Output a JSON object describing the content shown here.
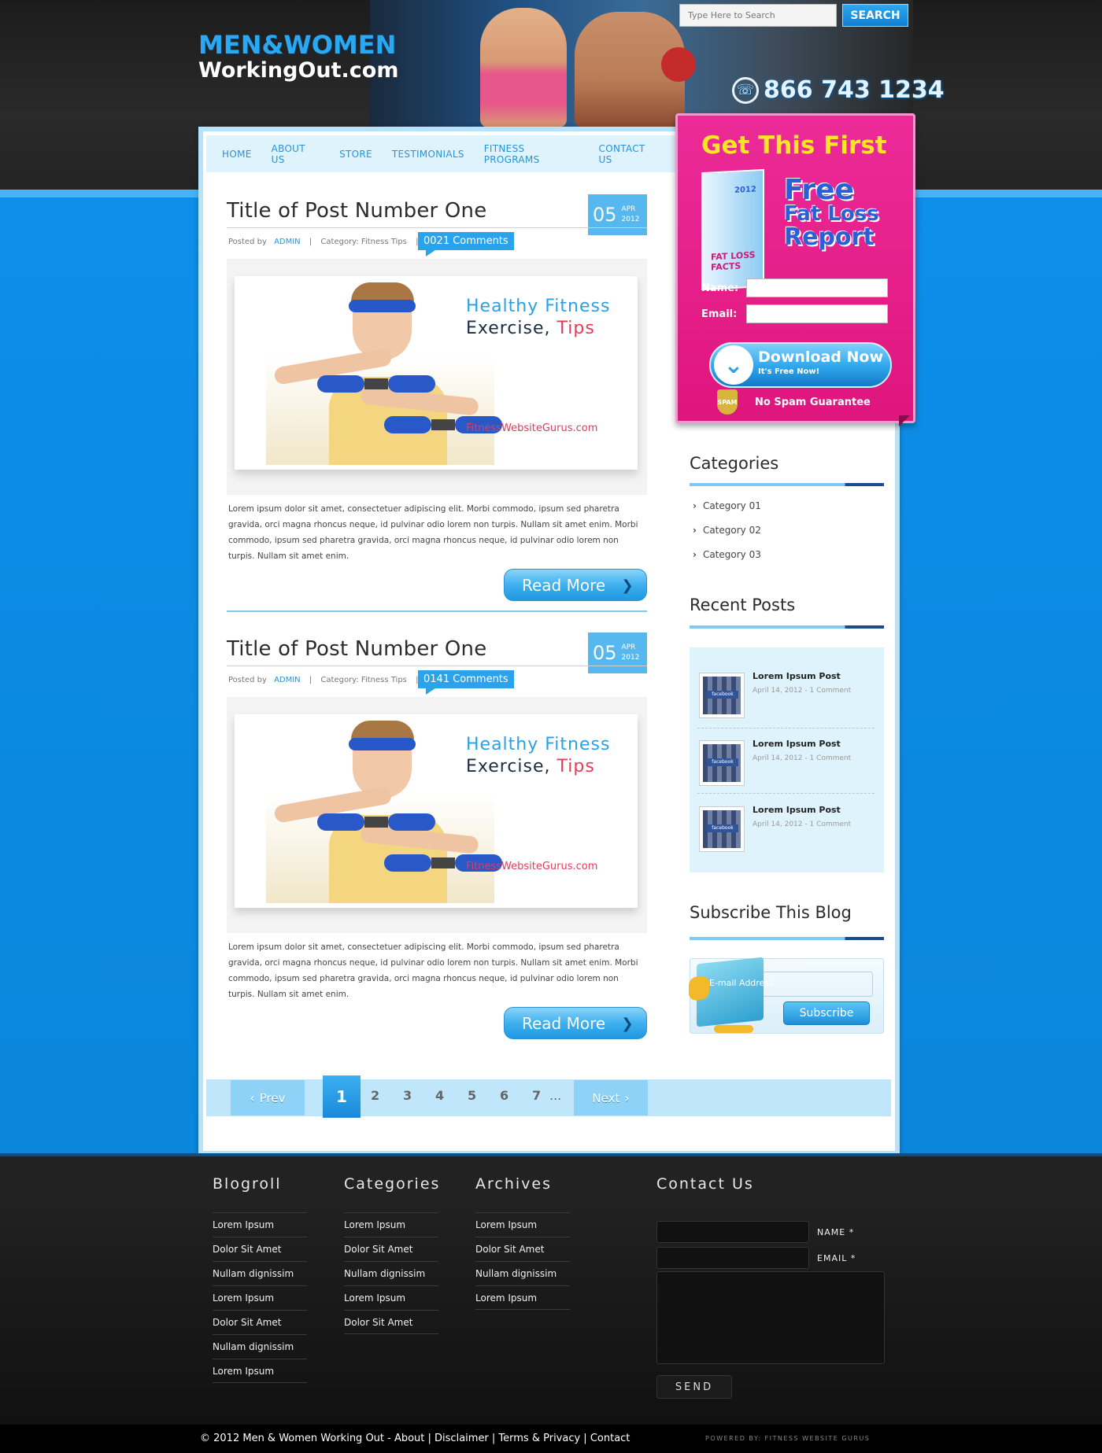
{
  "header": {
    "logo_line1": "MEN&WOMEN",
    "logo_line2": "WorkingOut.com",
    "search_placeholder": "Type Here to Search",
    "search_button": "SEARCH",
    "phone": "866 743 1234"
  },
  "nav": {
    "items": [
      "HOME",
      "ABOUT US",
      "STORE",
      "TESTIMONIALS",
      "FITNESS PROGRAMS",
      "CONTACT US"
    ]
  },
  "posts": [
    {
      "title": "Title of Post Number One",
      "day": "05",
      "month": "APR",
      "year": "2012",
      "posted_by": "Posted by",
      "author": "ADMIN",
      "category": "Category: Fitness Tips",
      "comments": "0021 Comments",
      "image_text1": "Healthy Fitness",
      "image_text2a": "Exercise,",
      "image_text2b": "Tips",
      "image_site": "FitnessWebsiteGurus.com",
      "body": "Lorem ipsum dolor sit amet, consectetuer adipiscing elit. Morbi commodo, ipsum sed pharetra gravida, orci magna rhoncus neque, id pulvinar odio lorem non turpis. Nullam sit amet enim. Morbi commodo, ipsum sed pharetra gravida, orci magna rhoncus neque, id pulvinar odio lorem non turpis. Nullam sit amet enim.",
      "read_more": "Read More"
    },
    {
      "title": "Title of Post Number One",
      "day": "05",
      "month": "APR",
      "year": "2012",
      "posted_by": "Posted by",
      "author": "ADMIN",
      "category": "Category: Fitness Tips",
      "comments": "0141 Comments",
      "image_text1": "Healthy Fitness",
      "image_text2a": "Exercise,",
      "image_text2b": "Tips",
      "image_site": "FitnessWebsiteGurus.com",
      "body": "Lorem ipsum dolor sit amet, consectetuer adipiscing elit. Morbi commodo, ipsum sed pharetra gravida, orci magna rhoncus neque, id pulvinar odio lorem non turpis. Nullam sit amet enim. Morbi commodo, ipsum sed pharetra gravida, orci magna rhoncus neque, id pulvinar odio lorem non turpis. Nullam sit amet enim.",
      "read_more": "Read More"
    }
  ],
  "optin": {
    "headline": "Get This First",
    "book_label": "FAT LOSS FACTS",
    "book_year": "2012",
    "free_l1": "Free",
    "free_l2": "Fat Loss",
    "free_l3": "Report",
    "name_label": "Name:",
    "email_label": "Email:",
    "download": "Download Now",
    "download_sub": "It's Free Now!",
    "spam_badge": "SPAM",
    "no_spam": "No Spam Guarantee"
  },
  "sidebar": {
    "categories_title": "Categories",
    "categories": [
      "Category 01",
      "Category 02",
      "Category 03"
    ],
    "recent_title": "Recent Posts",
    "recent": [
      {
        "title": "Lorem Ipsum Post",
        "meta": "April 14, 2012  -  1 Comment"
      },
      {
        "title": "Lorem Ipsum Post",
        "meta": "April 14, 2012  -  1 Comment"
      },
      {
        "title": "Lorem Ipsum Post",
        "meta": "April 14, 2012  -  1 Comment"
      }
    ],
    "thumb_label": "facebook",
    "subscribe_title": "Subscribe This Blog",
    "subscribe_placeholder": "E-mail Address",
    "subscribe_button": "Subscribe"
  },
  "pager": {
    "prev": "Prev",
    "next": "Next",
    "active": "1",
    "pages": [
      "2",
      "3",
      "4",
      "5",
      "6",
      "7"
    ],
    "ellipsis": "..."
  },
  "footer": {
    "blogroll_title": "Blogroll",
    "blogroll": [
      "Lorem Ipsum",
      "Dolor Sit Amet",
      "Nullam dignissim",
      "Lorem Ipsum",
      "Dolor Sit Amet",
      "Nullam dignissim",
      "Lorem Ipsum"
    ],
    "categories_title": "Categories",
    "categories": [
      "Lorem Ipsum",
      "Dolor Sit Amet",
      "Nullam dignissim",
      "Lorem Ipsum",
      "Dolor Sit Amet"
    ],
    "archives_title": "Archives",
    "archives": [
      "Lorem Ipsum",
      "Dolor Sit Amet",
      "Nullam dignissim",
      "Lorem Ipsum"
    ],
    "contact_title": "Contact Us",
    "name_label": "NAME *",
    "email_label": "EMAIL *",
    "send": "SEND",
    "copyright": "© 2012 Men & Women Working Out - About | Disclaimer | Terms & Privacy | Contact",
    "powered": "POWERED BY: FITNESS WEBSITE GURUS"
  }
}
